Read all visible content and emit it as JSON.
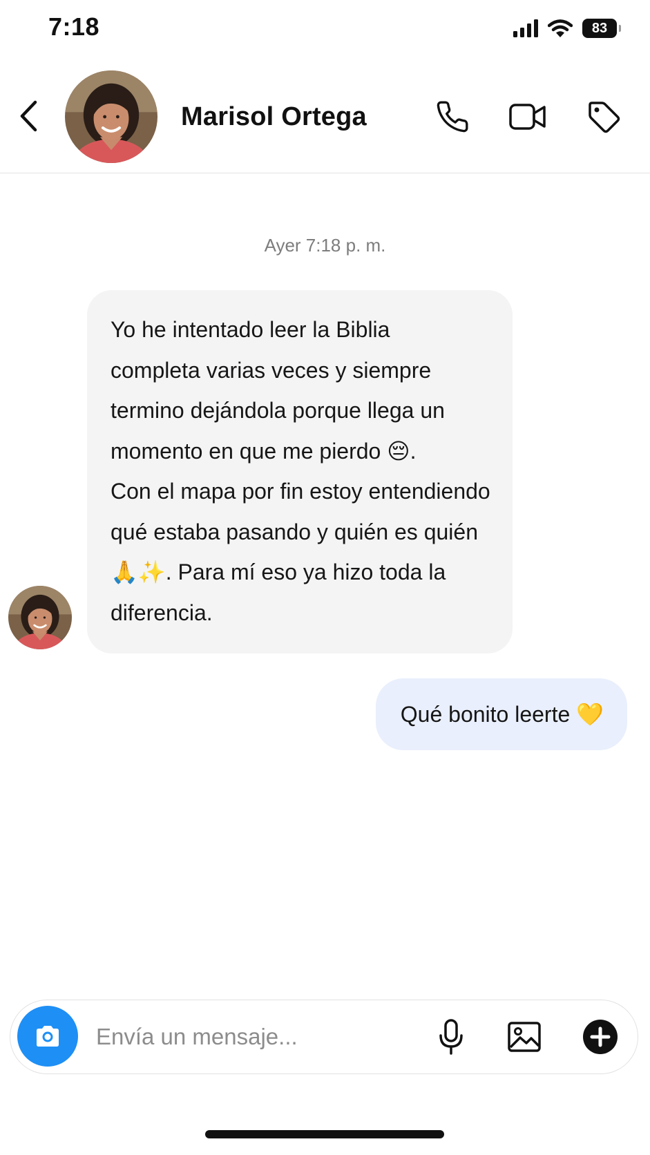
{
  "status_bar": {
    "time": "7:18",
    "battery": "83",
    "icons": [
      "signal-icon",
      "wifi-icon",
      "battery-icon"
    ]
  },
  "header": {
    "contact_name": "Marisol Ortega",
    "icons": [
      "back-chevron-icon",
      "avatar",
      "phone-icon",
      "video-camera-icon",
      "tag-icon"
    ]
  },
  "conversation": {
    "timestamp": "Ayer 7:18 p. m.",
    "messages": [
      {
        "direction": "incoming",
        "text": "Yo he intentado leer la Biblia\ncompleta varias veces y siempre\ntermino dejándola porque llega un\nmomento en que me pierdo 😔.\nCon el mapa por fin estoy entendiendo\nqué estaba pasando y quién es quién\n🙏✨. Para mí eso ya hizo toda la\ndiferencia."
      },
      {
        "direction": "outgoing",
        "text": "Qué bonito leerte 💛"
      }
    ]
  },
  "composer": {
    "placeholder": "Envía un mensaje...",
    "icons": [
      "camera-icon",
      "microphone-icon",
      "image-icon",
      "plus-icon"
    ]
  },
  "colors": {
    "accent": "#1e8ff5",
    "incoming_bubble": "#f4f4f5",
    "outgoing_bubble": "#e9effc",
    "timestamp": "#7d7d7d"
  }
}
